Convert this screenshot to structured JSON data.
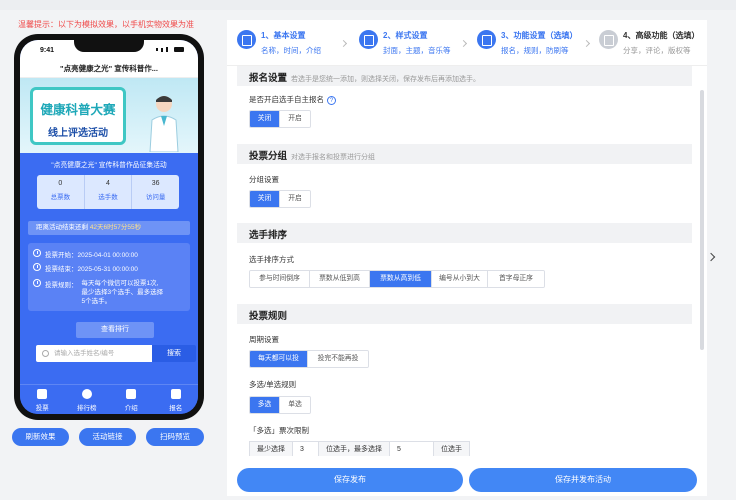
{
  "tip": "温馨提示：以下为模拟效果，以手机实物效果为准",
  "phone": {
    "time": "9:41",
    "nav_title": "\"点亮健康之光\" 宣传科普作...",
    "banner_line1": "健康科普大赛",
    "banner_line2": "线上评选活动",
    "subtitle": "\"点亮健康之光\" 宣传科普作品征集活动",
    "stats": [
      {
        "num": "0",
        "label": "总票数"
      },
      {
        "num": "4",
        "label": "选手数"
      },
      {
        "num": "36",
        "label": "访问量"
      }
    ],
    "countdown_prefix": "距离活动结束还剩",
    "countdown_value": "42天6时57分55秒",
    "start_label": "投票开始：2025-04-01 00:00:00",
    "end_label": "投票结束：2025-05-31 00:00:00",
    "rule_prefix": "投票规则：",
    "rule_lines": [
      "每天每个微信可以投票1次,",
      "最少选择3个选手、最多选择",
      "5个选手。"
    ],
    "rank_button": "查看排行",
    "search_placeholder": "请输入选手姓名/编号",
    "search_button": "搜索",
    "tabs": [
      "投票",
      "排行榜",
      "介绍",
      "报名"
    ]
  },
  "phone_actions": [
    "刷新效果",
    "活动链接",
    "扫码预览"
  ],
  "steps": [
    {
      "title": "1、基本设置",
      "sub": "名称，时间，介绍",
      "active": true
    },
    {
      "title": "2、样式设置",
      "sub": "封面，主题，音乐等",
      "active": true
    },
    {
      "title": "3、功能设置（选填）",
      "sub": "报名，规则，防刷等",
      "active": true
    },
    {
      "title": "4、高级功能（选填）",
      "sub": "分享，评论，版权等",
      "active": false
    }
  ],
  "sections": {
    "signup": {
      "title": "报名设置",
      "desc": "若选手是您统一添加，则选择关闭，保存发布后再添加选手。",
      "field": "是否开启选手自主报名",
      "options": [
        "关闭",
        "开启"
      ]
    },
    "group": {
      "title": "投票分组",
      "desc": "对选手报名和投票进行分组",
      "field": "分组设置",
      "options": [
        "关闭",
        "开启"
      ]
    },
    "sort": {
      "title": "选手排序",
      "field": "选手排序方式",
      "options": [
        "参与时间倒序",
        "票数从低到高",
        "票数从高到低",
        "编号从小到大",
        "首字母正序"
      ]
    },
    "rules": {
      "title": "投票规则",
      "period_field": "周期设置",
      "period_options": [
        "每天都可以投",
        "投完不能再投"
      ],
      "mode_field": "多选/单选规则",
      "mode_options": [
        "多选",
        "单选"
      ],
      "limit_field": "「多选」票次限制",
      "limit_min_label": "最少选择",
      "limit_min": "3",
      "limit_mid_label": "位选手，最多选择",
      "limit_max": "5",
      "limit_end_label": "位选手"
    }
  },
  "bottom_buttons": [
    "保存发布",
    "保存并发布活动"
  ]
}
